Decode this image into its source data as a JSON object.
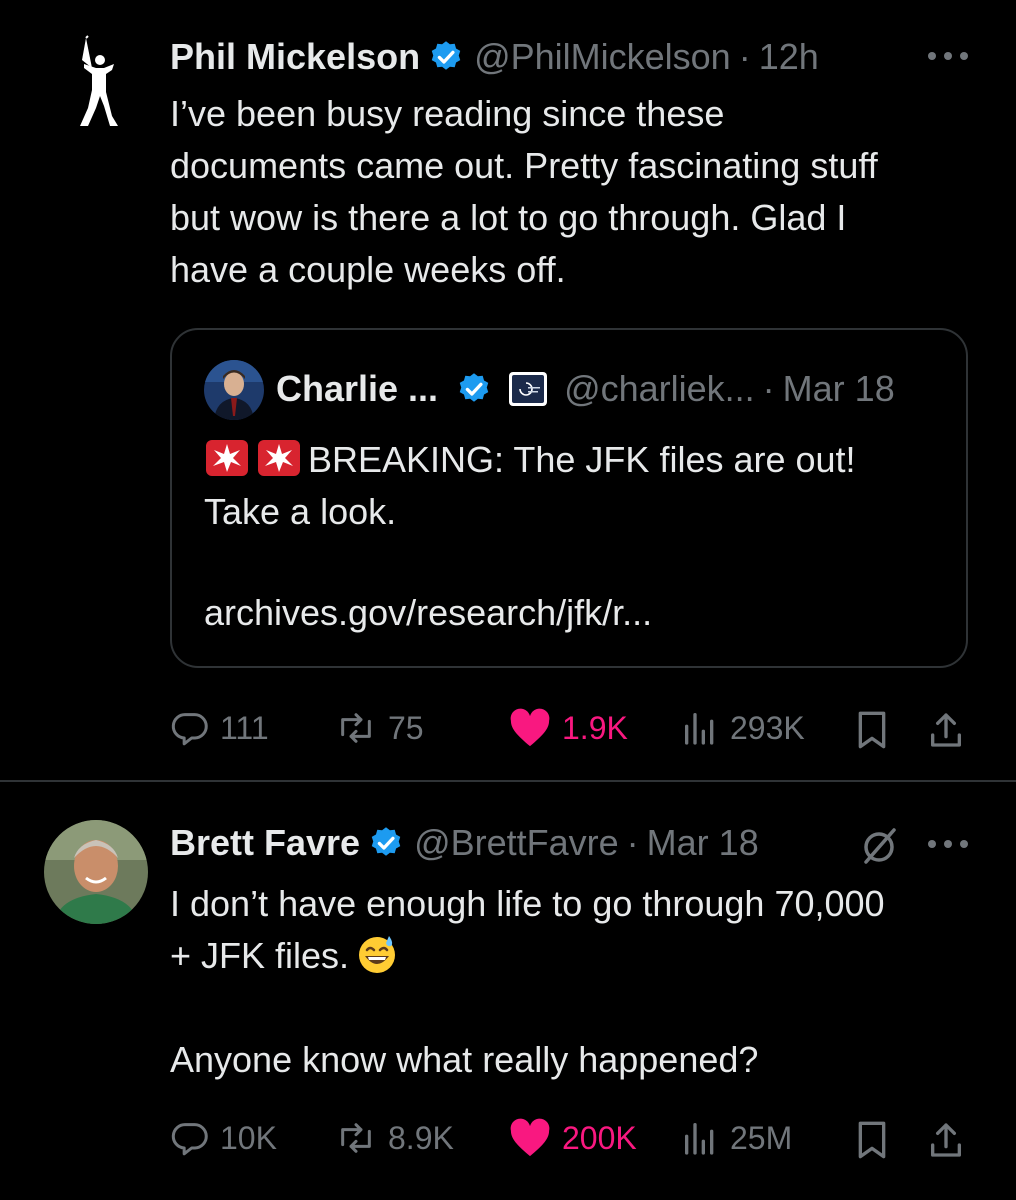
{
  "tweet1": {
    "author_name": "Phil Mickelson",
    "handle": "@PhilMickelson",
    "separator": "·",
    "time": "12h",
    "text_lines": [
      "I’ve been busy reading since these",
      "documents came out. Pretty fascinating stuff",
      "but wow is there a lot to go through. Glad I",
      "have a couple weeks off."
    ],
    "quote": {
      "author_name": "Charlie ...",
      "handle": "@charliek...",
      "separator": "·",
      "time": "Mar 18",
      "text_line1": "BREAKING: The JFK files are out!",
      "text_line2": "Take a look.",
      "link": "archives.gov/research/jfk/r..."
    },
    "stats": {
      "replies": "111",
      "reposts": "75",
      "likes": "1.9K",
      "views": "293K"
    }
  },
  "tweet2": {
    "author_name": "Brett Favre",
    "handle": "@BrettFavre",
    "separator": "·",
    "time": "Mar 18",
    "text_line1": "I don’t have enough life to go through 70,000",
    "text_line2": "+ JFK files.",
    "text_line3": "Anyone know what really happened?",
    "stats": {
      "replies": "10K",
      "reposts": "8.9K",
      "likes": "200K",
      "views": "25M"
    }
  },
  "colors": {
    "background": "#000000",
    "text": "#e7e9ea",
    "muted": "#71767b",
    "like": "#f91880",
    "verified": "#1d9bf0",
    "border": "#2f3336"
  },
  "icons": [
    "verified-badge-icon",
    "more-icon",
    "reply-icon",
    "repost-icon",
    "like-icon",
    "views-icon",
    "bookmark-icon",
    "share-icon",
    "grok-icon",
    "siren-emoji",
    "sweat-smile-emoji"
  ]
}
